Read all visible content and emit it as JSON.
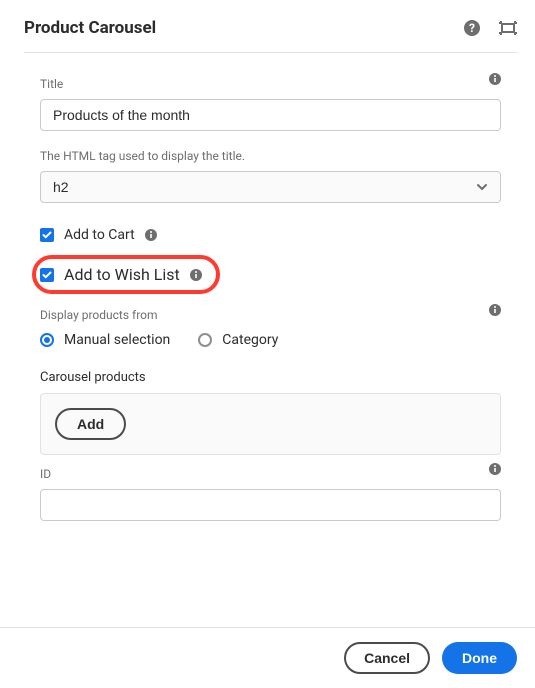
{
  "header": {
    "title": "Product Carousel"
  },
  "fields": {
    "title_label": "Title",
    "title_value": "Products of the month",
    "tag_label": "The HTML tag used to display the title.",
    "tag_value": "h2",
    "add_to_cart_label": "Add to Cart",
    "add_to_wishlist_label": "Add to Wish List",
    "display_from_label": "Display products from",
    "radio_manual": "Manual selection",
    "radio_category": "Category",
    "carousel_products_label": "Carousel products",
    "add_button": "Add",
    "id_label": "ID",
    "id_value": ""
  },
  "footer": {
    "cancel": "Cancel",
    "done": "Done"
  }
}
